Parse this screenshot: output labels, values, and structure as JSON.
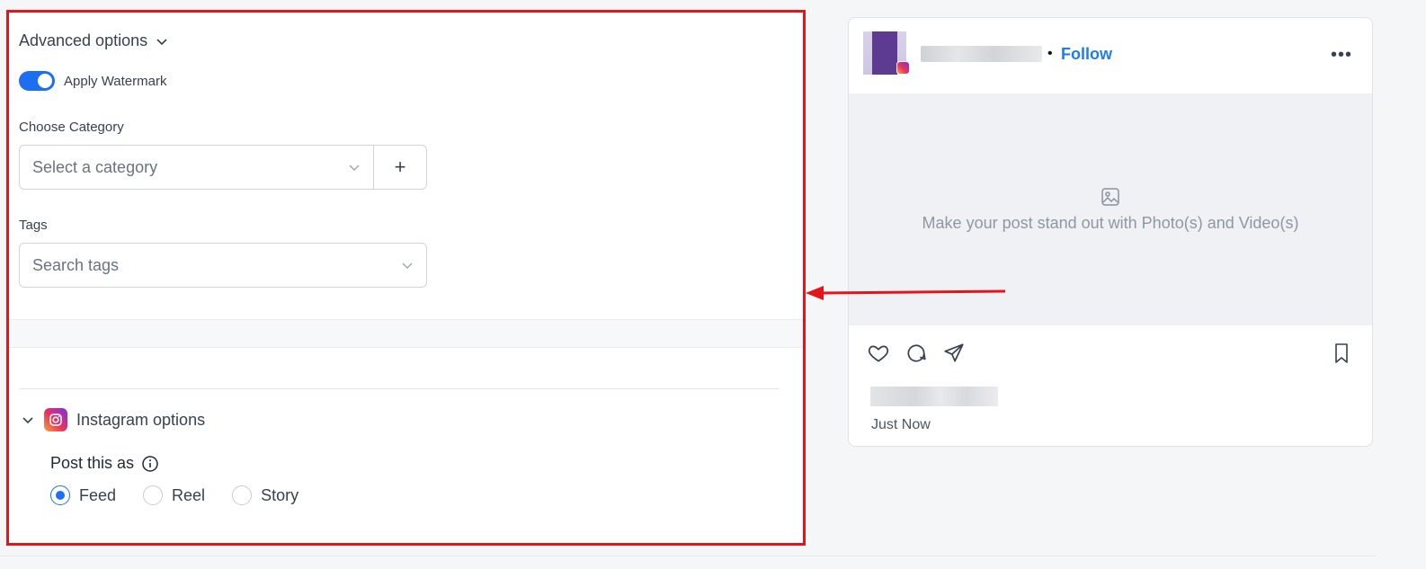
{
  "advanced_options": {
    "title": "Advanced options",
    "watermark_label": "Apply Watermark",
    "watermark_on": true
  },
  "category": {
    "label": "Choose Category",
    "placeholder": "Select a category",
    "add_icon": "+"
  },
  "tags": {
    "label": "Tags",
    "placeholder": "Search tags"
  },
  "instagram_options": {
    "title": "Instagram options",
    "post_as_label": "Post this as",
    "radio_options": [
      {
        "label": "Feed",
        "selected": true
      },
      {
        "label": "Reel",
        "selected": false
      },
      {
        "label": "Story",
        "selected": false
      }
    ]
  },
  "preview": {
    "follow_label": "Follow",
    "separator": "•",
    "more_icon": "•••",
    "media_placeholder": "Make your post stand out with Photo(s) and Video(s)",
    "timestamp": "Just Now"
  },
  "colors": {
    "accent": "#1d6ff2",
    "highlight": "#e4141b",
    "follow": "#1d7cf2"
  }
}
